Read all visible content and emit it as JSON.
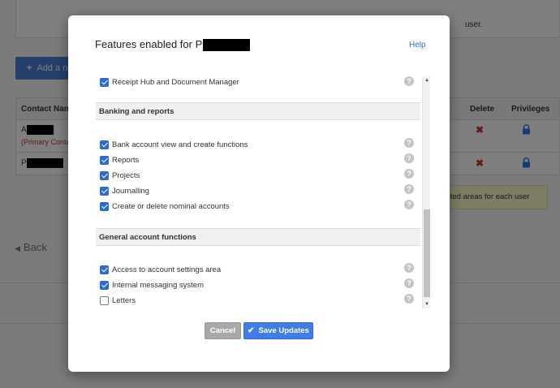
{
  "background": {
    "top_notice_fragment": "user.",
    "add_button_label": "Add a n",
    "table": {
      "headers": {
        "contact_name": "Contact Name",
        "delete": "Delete",
        "privileges": "Privileges"
      },
      "rows": [
        {
          "name_prefix": "A",
          "note": "(Primary Contac"
        },
        {
          "name_prefix": "P",
          "note": ""
        }
      ]
    },
    "tooltip_fragment": "cted areas for each user",
    "back_label": "Back"
  },
  "modal": {
    "title_prefix": "Features enabled for P",
    "help_label": "Help",
    "items_top": [
      {
        "label": "Receipt Hub and Document Manager",
        "checked": true
      }
    ],
    "sections": [
      {
        "title": "Banking and reports",
        "items": [
          {
            "label": "Bank account view and create functions",
            "checked": true
          },
          {
            "label": "Reports",
            "checked": true
          },
          {
            "label": "Projects",
            "checked": true
          },
          {
            "label": "Journalling",
            "checked": true
          },
          {
            "label": "Create or delete nominal accounts",
            "checked": true
          }
        ]
      },
      {
        "title": "General account functions",
        "items": [
          {
            "label": "Access to account settings area",
            "checked": true
          },
          {
            "label": "Internal messaging system",
            "checked": true
          },
          {
            "label": "Letters",
            "checked": false
          }
        ]
      }
    ],
    "cancel_label": "Cancel",
    "save_label": "Save Updates"
  },
  "icons": {
    "help": "question-circle-icon",
    "delete": "x-icon",
    "privileges": "lock-icon",
    "save": "checkmark-icon",
    "back": "caret-left-icon",
    "add": "plus-icon"
  },
  "colors": {
    "primary_blue": "#3f7ee8",
    "delete_red": "#c0392b",
    "lock_blue": "#2c7be5",
    "tooltip_yellow": "#fcf8c8"
  }
}
